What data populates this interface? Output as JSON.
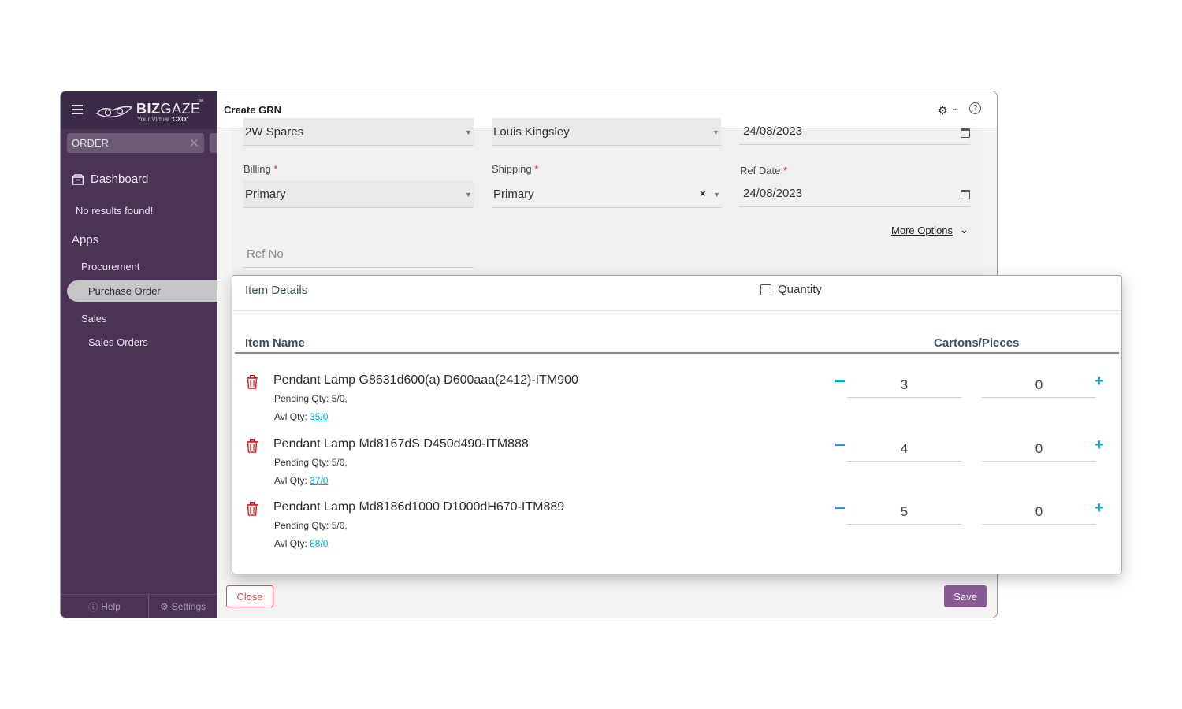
{
  "app": {
    "logo_word_bold": "BIZ",
    "logo_word_thin": "GAZE",
    "logo_tm": "™",
    "logo_tagline_prefix": "Your Virtual ",
    "logo_tagline_bold": "'CXO'"
  },
  "sidebar": {
    "search_value": "ORDER",
    "search_clear": "✕",
    "dashboard_label": "Dashboard",
    "no_results": "No results found!",
    "apps_heading": "Apps",
    "items": [
      {
        "label": "Procurement"
      },
      {
        "label": "Purchase Order"
      },
      {
        "label": "Sales"
      },
      {
        "label": "Sales Orders"
      }
    ],
    "footer": {
      "help": "Help",
      "settings": "Settings"
    }
  },
  "header": {
    "title": "Create GRN"
  },
  "form": {
    "row1": {
      "branch": "2W Spares",
      "supplier": "Louis Kingsley",
      "date": "24/08/2023"
    },
    "billing": {
      "label": "Billing",
      "value": "Primary"
    },
    "shipping": {
      "label": "Shipping",
      "value": "Primary"
    },
    "ref_date": {
      "label": "Ref Date",
      "value": "24/08/2023"
    },
    "required_mark": "*",
    "more_options": "More Options",
    "ref_no_placeholder": "Ref No"
  },
  "popup": {
    "title": "Item Details",
    "quantity_checkbox_label": "Quantity",
    "columns": {
      "name": "Item Name",
      "cartons_pieces": "Cartons/Pieces"
    },
    "items": [
      {
        "name": "Pendant Lamp G8631d600(a) D600aaa(2412)-ITM900",
        "pending": "Pending Qty: 5/0,",
        "avl_label": "Avl Qty: ",
        "avl_link": "35/0 ",
        "cartons": "3",
        "pieces": "0"
      },
      {
        "name": "Pendant Lamp Md8167dS D450d490-ITM888",
        "pending": "Pending Qty: 5/0,",
        "avl_label": "Avl Qty: ",
        "avl_link": "37/0 ",
        "cartons": "4",
        "pieces": "0"
      },
      {
        "name": "Pendant Lamp Md8186d1000 D1000dH670-ITM889",
        "pending": "Pending Qty: 5/0,",
        "avl_label": "Avl Qty: ",
        "avl_link": "88/0 ",
        "cartons": "5",
        "pieces": "0"
      }
    ]
  },
  "footer": {
    "close": "Close",
    "save": "Save"
  },
  "colors": {
    "sidebar": "#4a3355",
    "accent": "#13a6d8",
    "save": "#8a5a96",
    "danger": "#e04b4b"
  },
  "icons": [
    "menu-icon",
    "search-clear-icon",
    "dashboard-icon",
    "gear-icon",
    "help-icon",
    "calendar-icon",
    "trash-icon",
    "minus-icon",
    "plus-icon",
    "chevron-down-icon"
  ]
}
